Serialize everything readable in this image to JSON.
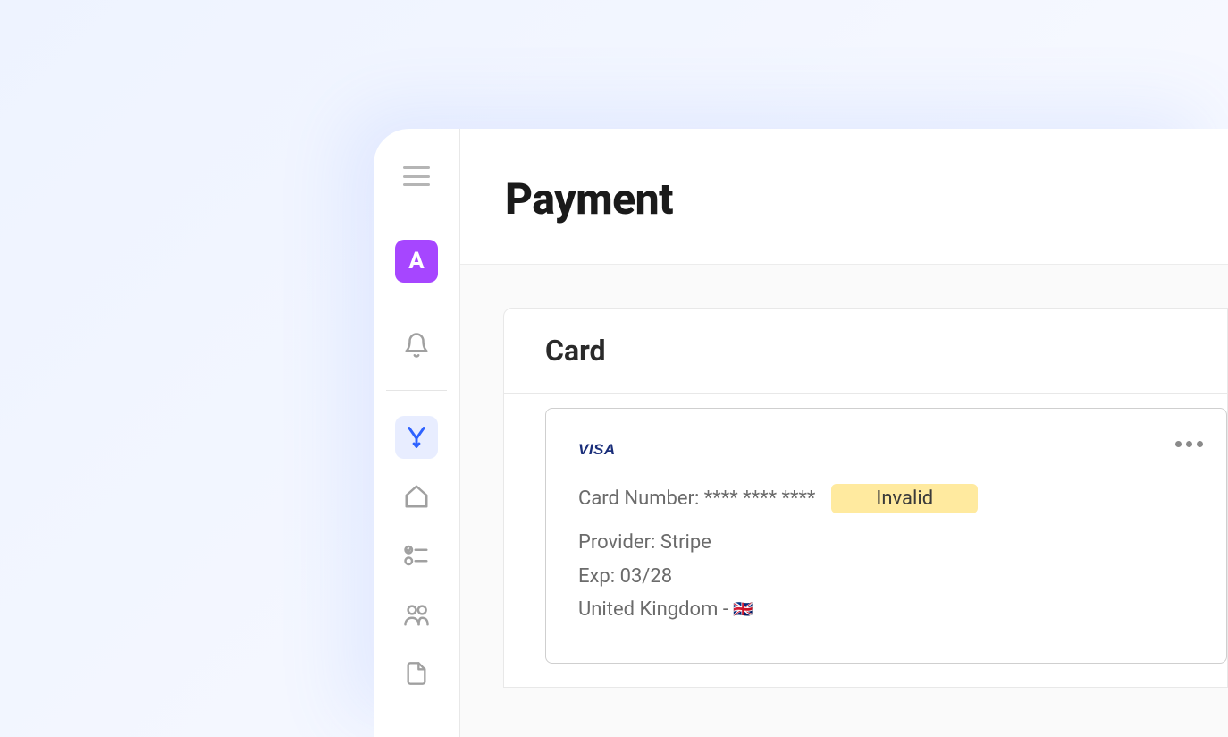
{
  "sidebar": {
    "avatar_letter": "A",
    "icons": {
      "menu": "menu-icon",
      "bell": "bell-icon",
      "funnel": "funnel-icon",
      "home": "home-icon",
      "checklist": "checklist-icon",
      "people": "people-icon",
      "document": "document-icon"
    }
  },
  "header": {
    "title": "Payment"
  },
  "card_panel": {
    "title": "Card",
    "card": {
      "brand": "VISA",
      "number_label": "Card Number:",
      "number_masked": "**** **** ****",
      "status": "Invalid",
      "provider_label": "Provider:",
      "provider_value": "Stripe",
      "exp_label": "Exp:",
      "exp_value": "03/28",
      "country_label": "United Kingdom -",
      "country_flag": "🇬🇧"
    }
  }
}
